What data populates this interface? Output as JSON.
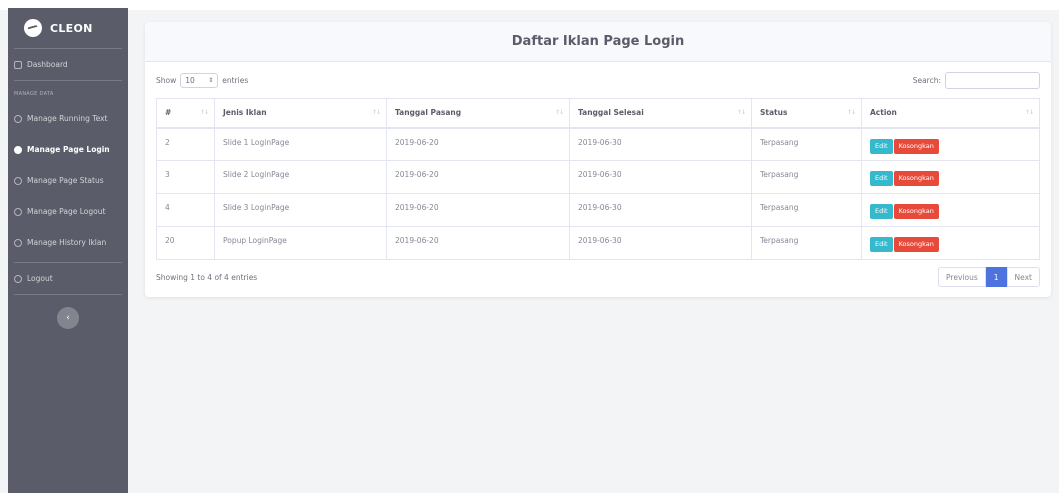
{
  "brand": {
    "name": "CLEON"
  },
  "sidebar": {
    "dashboard": "Dashboard",
    "section_heading": "MANAGE DATA",
    "items": [
      {
        "label": "Manage Running Text",
        "active": false
      },
      {
        "label": "Manage Page Login",
        "active": true
      },
      {
        "label": "Manage Page Status",
        "active": false
      },
      {
        "label": "Manage Page Logout",
        "active": false
      },
      {
        "label": "Manage History Iklan",
        "active": false
      }
    ],
    "logout": "Logout",
    "toggle": "‹"
  },
  "card": {
    "title": "Daftar Iklan Page Login"
  },
  "controls": {
    "show_label": "Show",
    "page_length": "10",
    "entries_label": "entries",
    "search_label": "Search:",
    "search_value": ""
  },
  "table": {
    "columns": [
      "#",
      "Jenis Iklan",
      "Tanggal Pasang",
      "Tanggal Selesai",
      "Status",
      "Action"
    ],
    "rows": [
      {
        "id": "2",
        "jenis": "Slide 1 LoginPage",
        "pasang": "2019-06-20",
        "selesai": "2019-06-30",
        "status": "Terpasang"
      },
      {
        "id": "3",
        "jenis": "Slide 2 LoginPage",
        "pasang": "2019-06-20",
        "selesai": "2019-06-30",
        "status": "Terpasang"
      },
      {
        "id": "4",
        "jenis": "Slide 3 LoginPage",
        "pasang": "2019-06-20",
        "selesai": "2019-06-30",
        "status": "Terpasang"
      },
      {
        "id": "20",
        "jenis": "Popup LoginPage",
        "pasang": "2019-06-20",
        "selesai": "2019-06-30",
        "status": "Terpasang"
      }
    ],
    "edit_label": "Edit",
    "empty_label": "Kosongkan"
  },
  "footer": {
    "info": "Showing 1 to 4 of 4 entries",
    "previous": "Previous",
    "page": "1",
    "next": "Next"
  }
}
